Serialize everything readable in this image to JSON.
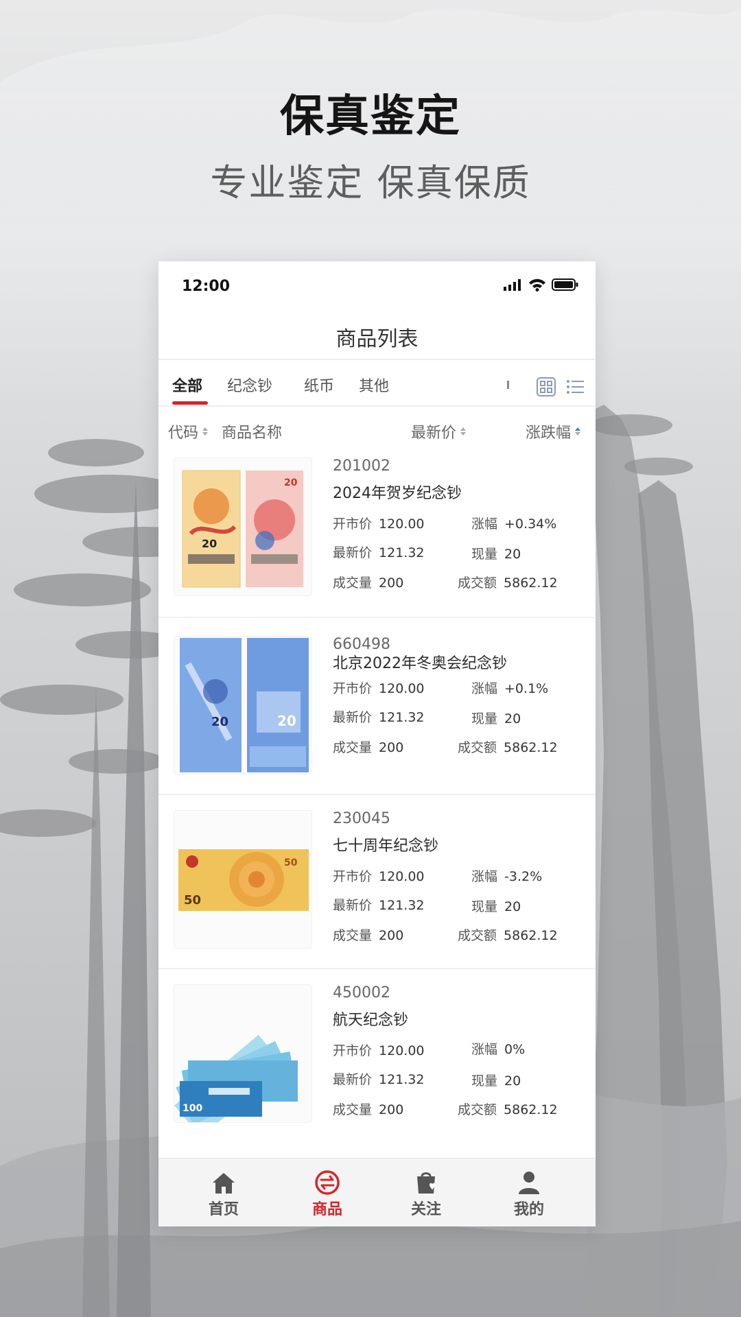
{
  "hero": {
    "title": "保真鉴定",
    "subtitle": "专业鉴定 保真保质"
  },
  "status_bar": {
    "time": "12:00"
  },
  "nav": {
    "title": "商品列表"
  },
  "tabs": [
    {
      "label": "全部",
      "active": true
    },
    {
      "label": "纪念钞",
      "active": false
    },
    {
      "label": "纸币",
      "active": false
    },
    {
      "label": "其他",
      "active": false
    }
  ],
  "sort_header": {
    "code": "代码",
    "name": "商品名称",
    "price": "最新价",
    "change": "涨跌幅"
  },
  "field_labels": {
    "open": "开市价",
    "change": "涨幅",
    "latest": "最新价",
    "qty": "现量",
    "volume": "成交量",
    "amount": "成交额"
  },
  "products": [
    {
      "code": "201002",
      "name": "2024年贺岁纪念钞",
      "open": "120.00",
      "change": "+0.34%",
      "trend": "up",
      "latest": "121.32",
      "qty": "20",
      "volume": "200",
      "amount": "5862.12"
    },
    {
      "code": "660498",
      "name": "北京2022年冬奥会纪念钞",
      "open": "120.00",
      "change": "+0.1%",
      "trend": "up",
      "latest": "121.32",
      "qty": "20",
      "volume": "200",
      "amount": "5862.12"
    },
    {
      "code": "230045",
      "name": "七十周年纪念钞",
      "open": "120.00",
      "change": "-3.2%",
      "trend": "down",
      "latest": "121.32",
      "qty": "20",
      "volume": "200",
      "amount": "5862.12"
    },
    {
      "code": "450002",
      "name": "航天纪念钞",
      "open": "120.00",
      "change": "0%",
      "trend": "flat",
      "latest": "121.32",
      "qty": "20",
      "volume": "200",
      "amount": "5862.12"
    }
  ],
  "bottom_nav": [
    {
      "label": "首页",
      "icon": "home-icon",
      "active": false
    },
    {
      "label": "商品",
      "icon": "exchange-icon",
      "active": true
    },
    {
      "label": "关注",
      "icon": "bag-heart-icon",
      "active": false
    },
    {
      "label": "我的",
      "icon": "user-icon",
      "active": false
    }
  ],
  "colors": {
    "accent": "#d6252b",
    "up": "#e0383e",
    "down": "#3aa34b",
    "sort_active": "#4a79d8"
  }
}
